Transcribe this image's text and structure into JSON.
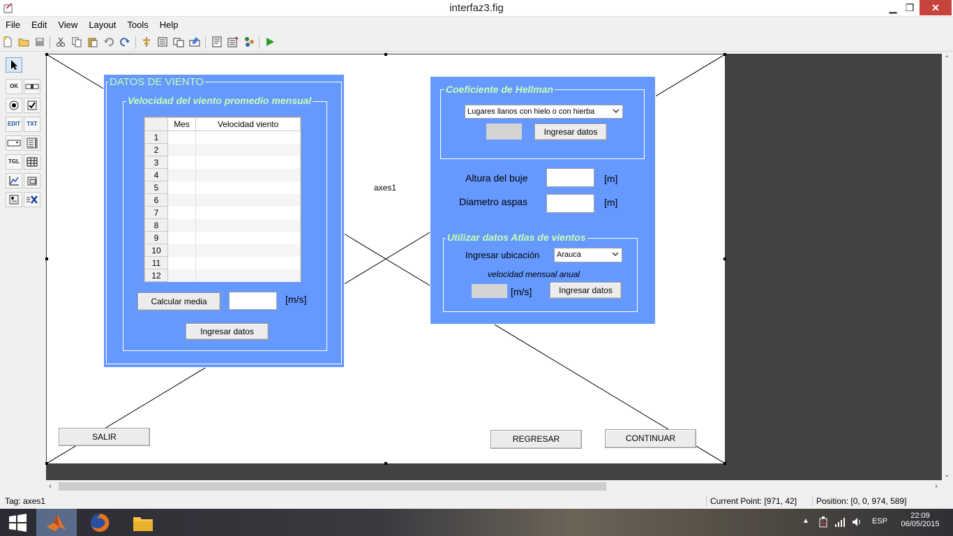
{
  "window": {
    "title": "interfaz3.fig",
    "minimize": "▁",
    "maximize": "❐",
    "close": "✕"
  },
  "menu": [
    "File",
    "Edit",
    "View",
    "Layout",
    "Tools",
    "Help"
  ],
  "palette": [
    "",
    "OK",
    "",
    "",
    "",
    "EDIT",
    "TXT",
    "",
    "",
    "TGL",
    "",
    "",
    "",
    "",
    ""
  ],
  "figure": {
    "axes_label": "axes1",
    "panel_viento": {
      "title": "DATOS DE VIENTO",
      "group_title": "Velocidad del viento promedio mensual",
      "table": {
        "headers": [
          "Mes",
          "Velocidad viento"
        ],
        "rows": [
          "1",
          "2",
          "3",
          "4",
          "5",
          "6",
          "7",
          "8",
          "9",
          "10",
          "11",
          "12"
        ]
      },
      "calcular_label": "Calcular media",
      "unit_ms": "[m/s]",
      "ingresar_label": "Ingresar datos"
    },
    "panel_hellman": {
      "group_title": "Coeficiente de Hellman",
      "dropdown_value": "Lugares llanos con hielo o con hierba",
      "ingresar_label": "Ingresar datos",
      "altura_label": "Altura del buje",
      "diametro_label": "Diametro aspas",
      "unit_m": "[m]",
      "atlas": {
        "group_title": "Utilizar datos Atlas de vientos",
        "ubicacion_label": "Ingresar ubicación",
        "ubicacion_value": "Arauca",
        "velocidad_label": "velocidad mensual anual",
        "unit_ms": "[m/s]",
        "ingresar_label": "Ingresar datos"
      }
    },
    "salir_label": "SALIR",
    "regresar_label": "REGRESAR",
    "continuar_label": "CONTINUAR"
  },
  "status": {
    "tag": "Tag: axes1",
    "current_point": "Current Point:  [971, 42]",
    "position": "Position: [0, 0, 974, 589]"
  },
  "taskbar": {
    "lang": "ESP",
    "time": "22:09",
    "date": "06/05/2015"
  },
  "colors": {
    "panel_bg": "#6699ff",
    "group_title": "#c7ffb0",
    "canvas_bg": "#424242"
  }
}
